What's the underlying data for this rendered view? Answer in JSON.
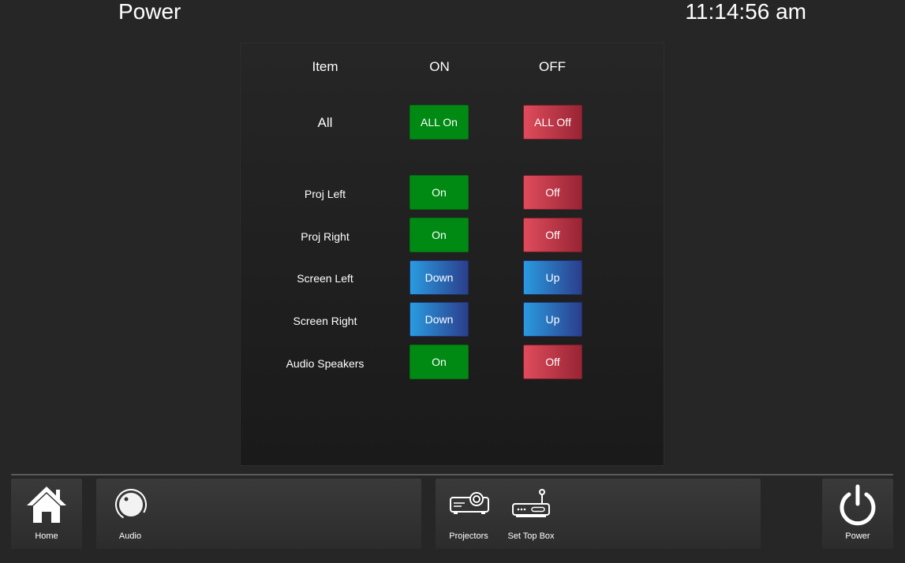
{
  "header": {
    "title": "Power",
    "clock": "11:14:56 am"
  },
  "table": {
    "columns": [
      "Item",
      "ON",
      "OFF"
    ],
    "all_row": {
      "label": "All",
      "on_label": "ALL On",
      "off_label": "ALL Off"
    },
    "rows": [
      {
        "label": "Proj Left",
        "on_label": "On",
        "off_label": "Off"
      },
      {
        "label": "Proj Right",
        "on_label": "On",
        "off_label": "Off"
      },
      {
        "label": "Screen Left",
        "on_label": "Down",
        "off_label": "Up"
      },
      {
        "label": "Screen Right",
        "on_label": "Down",
        "off_label": "Up"
      },
      {
        "label": "Audio Speakers",
        "on_label": "On",
        "off_label": "Off"
      }
    ]
  },
  "nav": {
    "home": {
      "label": "Home",
      "icon": "home-icon"
    },
    "audio": {
      "label": "Audio",
      "icon": "volume-knob-icon"
    },
    "projectors": {
      "label": "Projectors",
      "icon": "projector-icon"
    },
    "set_top_box": {
      "label": "Set Top Box",
      "icon": "set-top-box-icon"
    },
    "power": {
      "label": "Power",
      "icon": "power-icon"
    }
  },
  "colors": {
    "on_green": "#008a13",
    "off_red": "#df4c5c",
    "blue": "#2a9be0",
    "background": "#262626"
  }
}
